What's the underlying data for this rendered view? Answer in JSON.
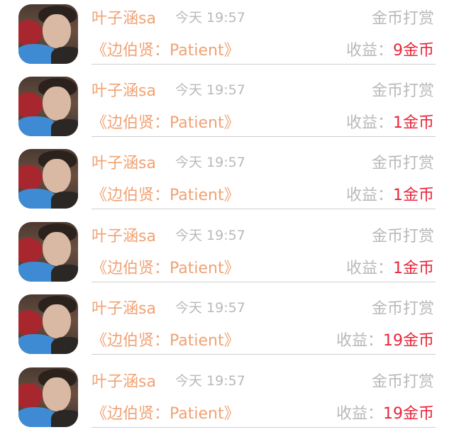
{
  "rows": [
    {
      "user": "叶子涵sa",
      "time": "今天 19:57",
      "type": "金币打赏",
      "item": "《边伯贤：Patient》",
      "income_label": "收益：",
      "amount": "9",
      "unit": "金币"
    },
    {
      "user": "叶子涵sa",
      "time": "今天 19:57",
      "type": "金币打赏",
      "item": "《边伯贤：Patient》",
      "income_label": "收益：",
      "amount": "1",
      "unit": "金币"
    },
    {
      "user": "叶子涵sa",
      "time": "今天 19:57",
      "type": "金币打赏",
      "item": "《边伯贤：Patient》",
      "income_label": "收益：",
      "amount": "1",
      "unit": "金币"
    },
    {
      "user": "叶子涵sa",
      "time": "今天 19:57",
      "type": "金币打赏",
      "item": "《边伯贤：Patient》",
      "income_label": "收益：",
      "amount": "1",
      "unit": "金币"
    },
    {
      "user": "叶子涵sa",
      "time": "今天 19:57",
      "type": "金币打赏",
      "item": "《边伯贤：Patient》",
      "income_label": "收益：",
      "amount": "19",
      "unit": "金币"
    },
    {
      "user": "叶子涵sa",
      "time": "今天 19:57",
      "type": "金币打赏",
      "item": "《边伯贤：Patient》",
      "income_label": "收益：",
      "amount": "19",
      "unit": "金币"
    }
  ],
  "colors": {
    "username": "#f0a274",
    "meta": "#b9b9b9",
    "amount": "#e8263a",
    "divider": "#cfcfcf"
  }
}
